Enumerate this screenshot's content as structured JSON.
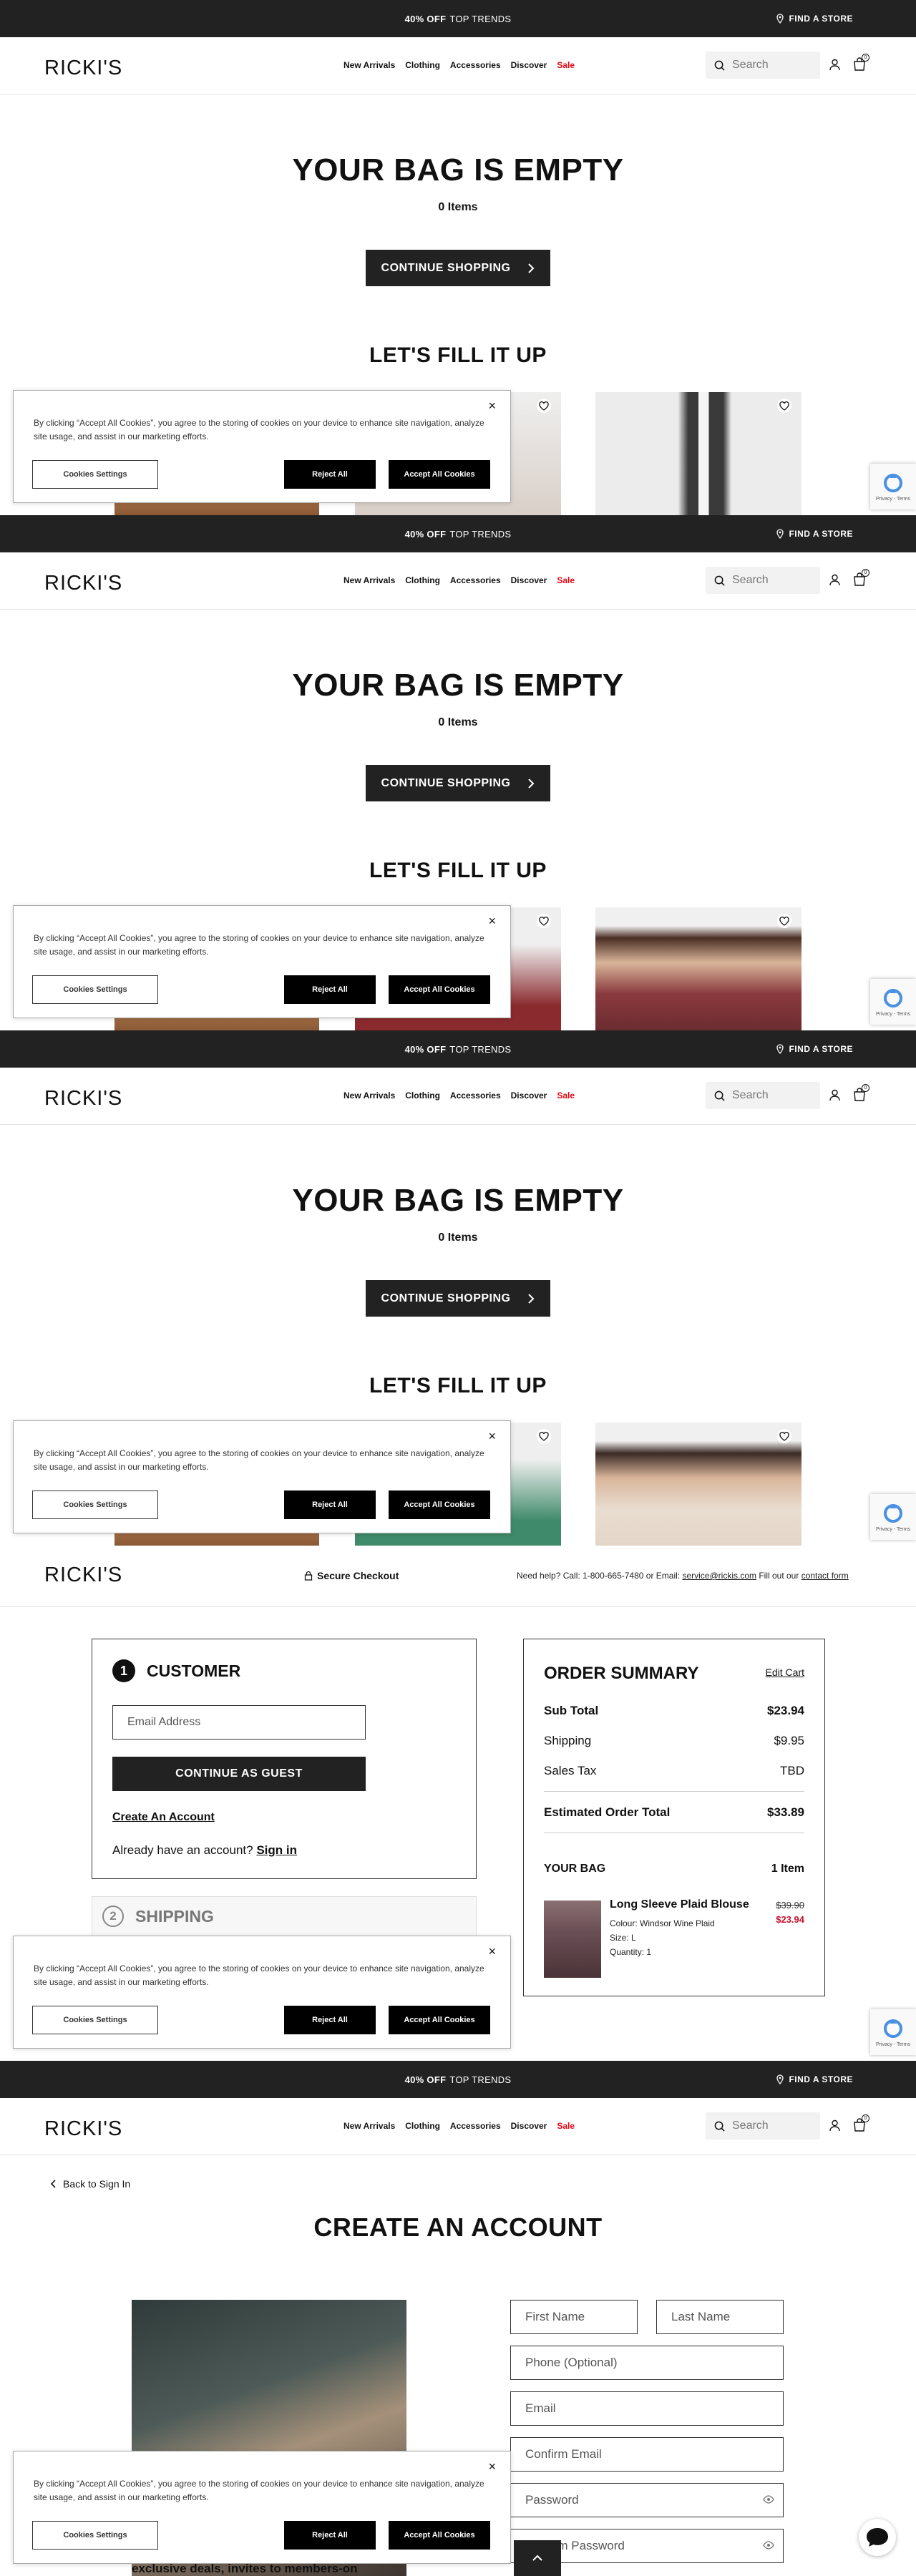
{
  "promo": {
    "bold": "40% OFF",
    "text": "TOP TRENDS",
    "find_store": "FIND A STORE"
  },
  "brand": {
    "logo": "RICKI'S"
  },
  "nav": {
    "items": [
      "New Arrivals",
      "Clothing",
      "Accessories",
      "Discover"
    ],
    "sale": "Sale"
  },
  "search": {
    "placeholder": "Search"
  },
  "bag": {
    "count": "0"
  },
  "empty_bag": {
    "title": "YOUR BAG IS EMPTY",
    "count": "0 Items",
    "continue_label": "CONTINUE SHOPPING",
    "fill_title": "LET'S FILL IT UP"
  },
  "cookie": {
    "text": "By clicking “Accept All Cookies”, you agree to the storing of cookies on your device to enhance site navigation, analyze site usage, and assist in our marketing efforts.",
    "settings_label": "Cookies Settings",
    "reject_label": "Reject All",
    "accept_label": "Accept All Cookies",
    "close": "×"
  },
  "recaptcha": {
    "text": "Privacy - Terms"
  },
  "checkout": {
    "secure": "Secure Checkout",
    "help": "Need help?  Call: 1-800-665-7480  or  Email: ",
    "help_email": "service@rickis.com",
    "help_mid": "  Fill out our ",
    "help_form": "contact form",
    "customer": {
      "step": "1",
      "title": "CUSTOMER",
      "email_placeholder": "Email Address",
      "guest_label": "CONTINUE AS GUEST",
      "create_label": "Create An Account",
      "already": "Already have an account?",
      "signin": "Sign in"
    },
    "shipping": {
      "step": "2",
      "title": "SHIPPING"
    },
    "summary": {
      "title": "ORDER SUMMARY",
      "edit": "Edit Cart",
      "rows": [
        {
          "label": "Sub Total",
          "value": "$23.94"
        },
        {
          "label": "Shipping",
          "value": "$9.95"
        },
        {
          "label": "Sales Tax",
          "value": "TBD"
        }
      ],
      "total_label": "Estimated Order Total",
      "total_value": "$33.89",
      "bag_label": "YOUR BAG",
      "bag_count": "1 Item",
      "item": {
        "name": "Long Sleeve Plaid Blouse",
        "colour": "Colour: Windsor Wine Plaid",
        "size": "Size: L",
        "qty": "Quantity: 1",
        "old_price": "$39.90",
        "new_price": "$23.94"
      }
    }
  },
  "create_account": {
    "back": "Back to Sign In",
    "title": "CREATE AN ACCOUNT",
    "first": "First Name",
    "last": "Last Name",
    "phone": "Phone (Optional)",
    "email": "Email",
    "confirm": "Confirm Email",
    "password": "Password",
    "confirm_password": "Confirm Password",
    "exclusive": "exclusive deals, invites to members-on"
  },
  "colors": {
    "dark": "#222222",
    "sale": "#e30613",
    "price_red": "#c8102e"
  }
}
